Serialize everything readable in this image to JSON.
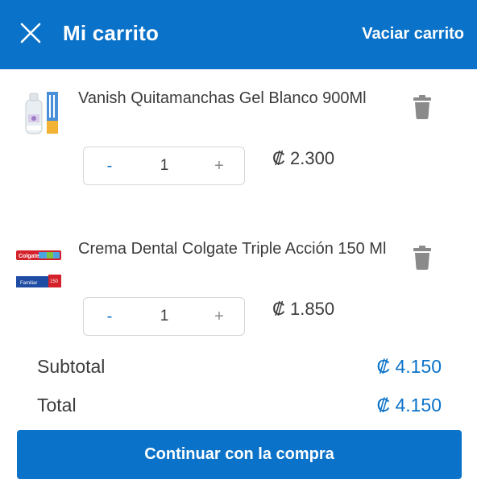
{
  "header": {
    "title": "Mi carrito",
    "empty_cart_label": "Vaciar carrito",
    "close_icon": "close-icon",
    "bg_color": "#0a72c9"
  },
  "items": [
    {
      "name": "Vanish Quitamanchas Gel Blanco 900Ml",
      "quantity": "1",
      "minus_label": "-",
      "plus_label": "+",
      "price": "₡ 2.300",
      "delete_icon": "trash-icon",
      "image_icon": "product-image"
    },
    {
      "name": "Crema Dental Colgate Triple Acción 150 Ml",
      "quantity": "1",
      "minus_label": "-",
      "plus_label": "+",
      "price": "₡ 1.850",
      "delete_icon": "trash-icon",
      "image_icon": "product-image"
    }
  ],
  "summary": {
    "subtotal_label": "Subtotal",
    "subtotal_value": "₡ 4.150",
    "total_label": "Total",
    "total_value": "₡ 4.150"
  },
  "checkout": {
    "label": "Continuar con la compra"
  },
  "colors": {
    "accent": "#0a72c9",
    "text": "#3b3b3b",
    "muted_icon": "#8a8a8a"
  }
}
